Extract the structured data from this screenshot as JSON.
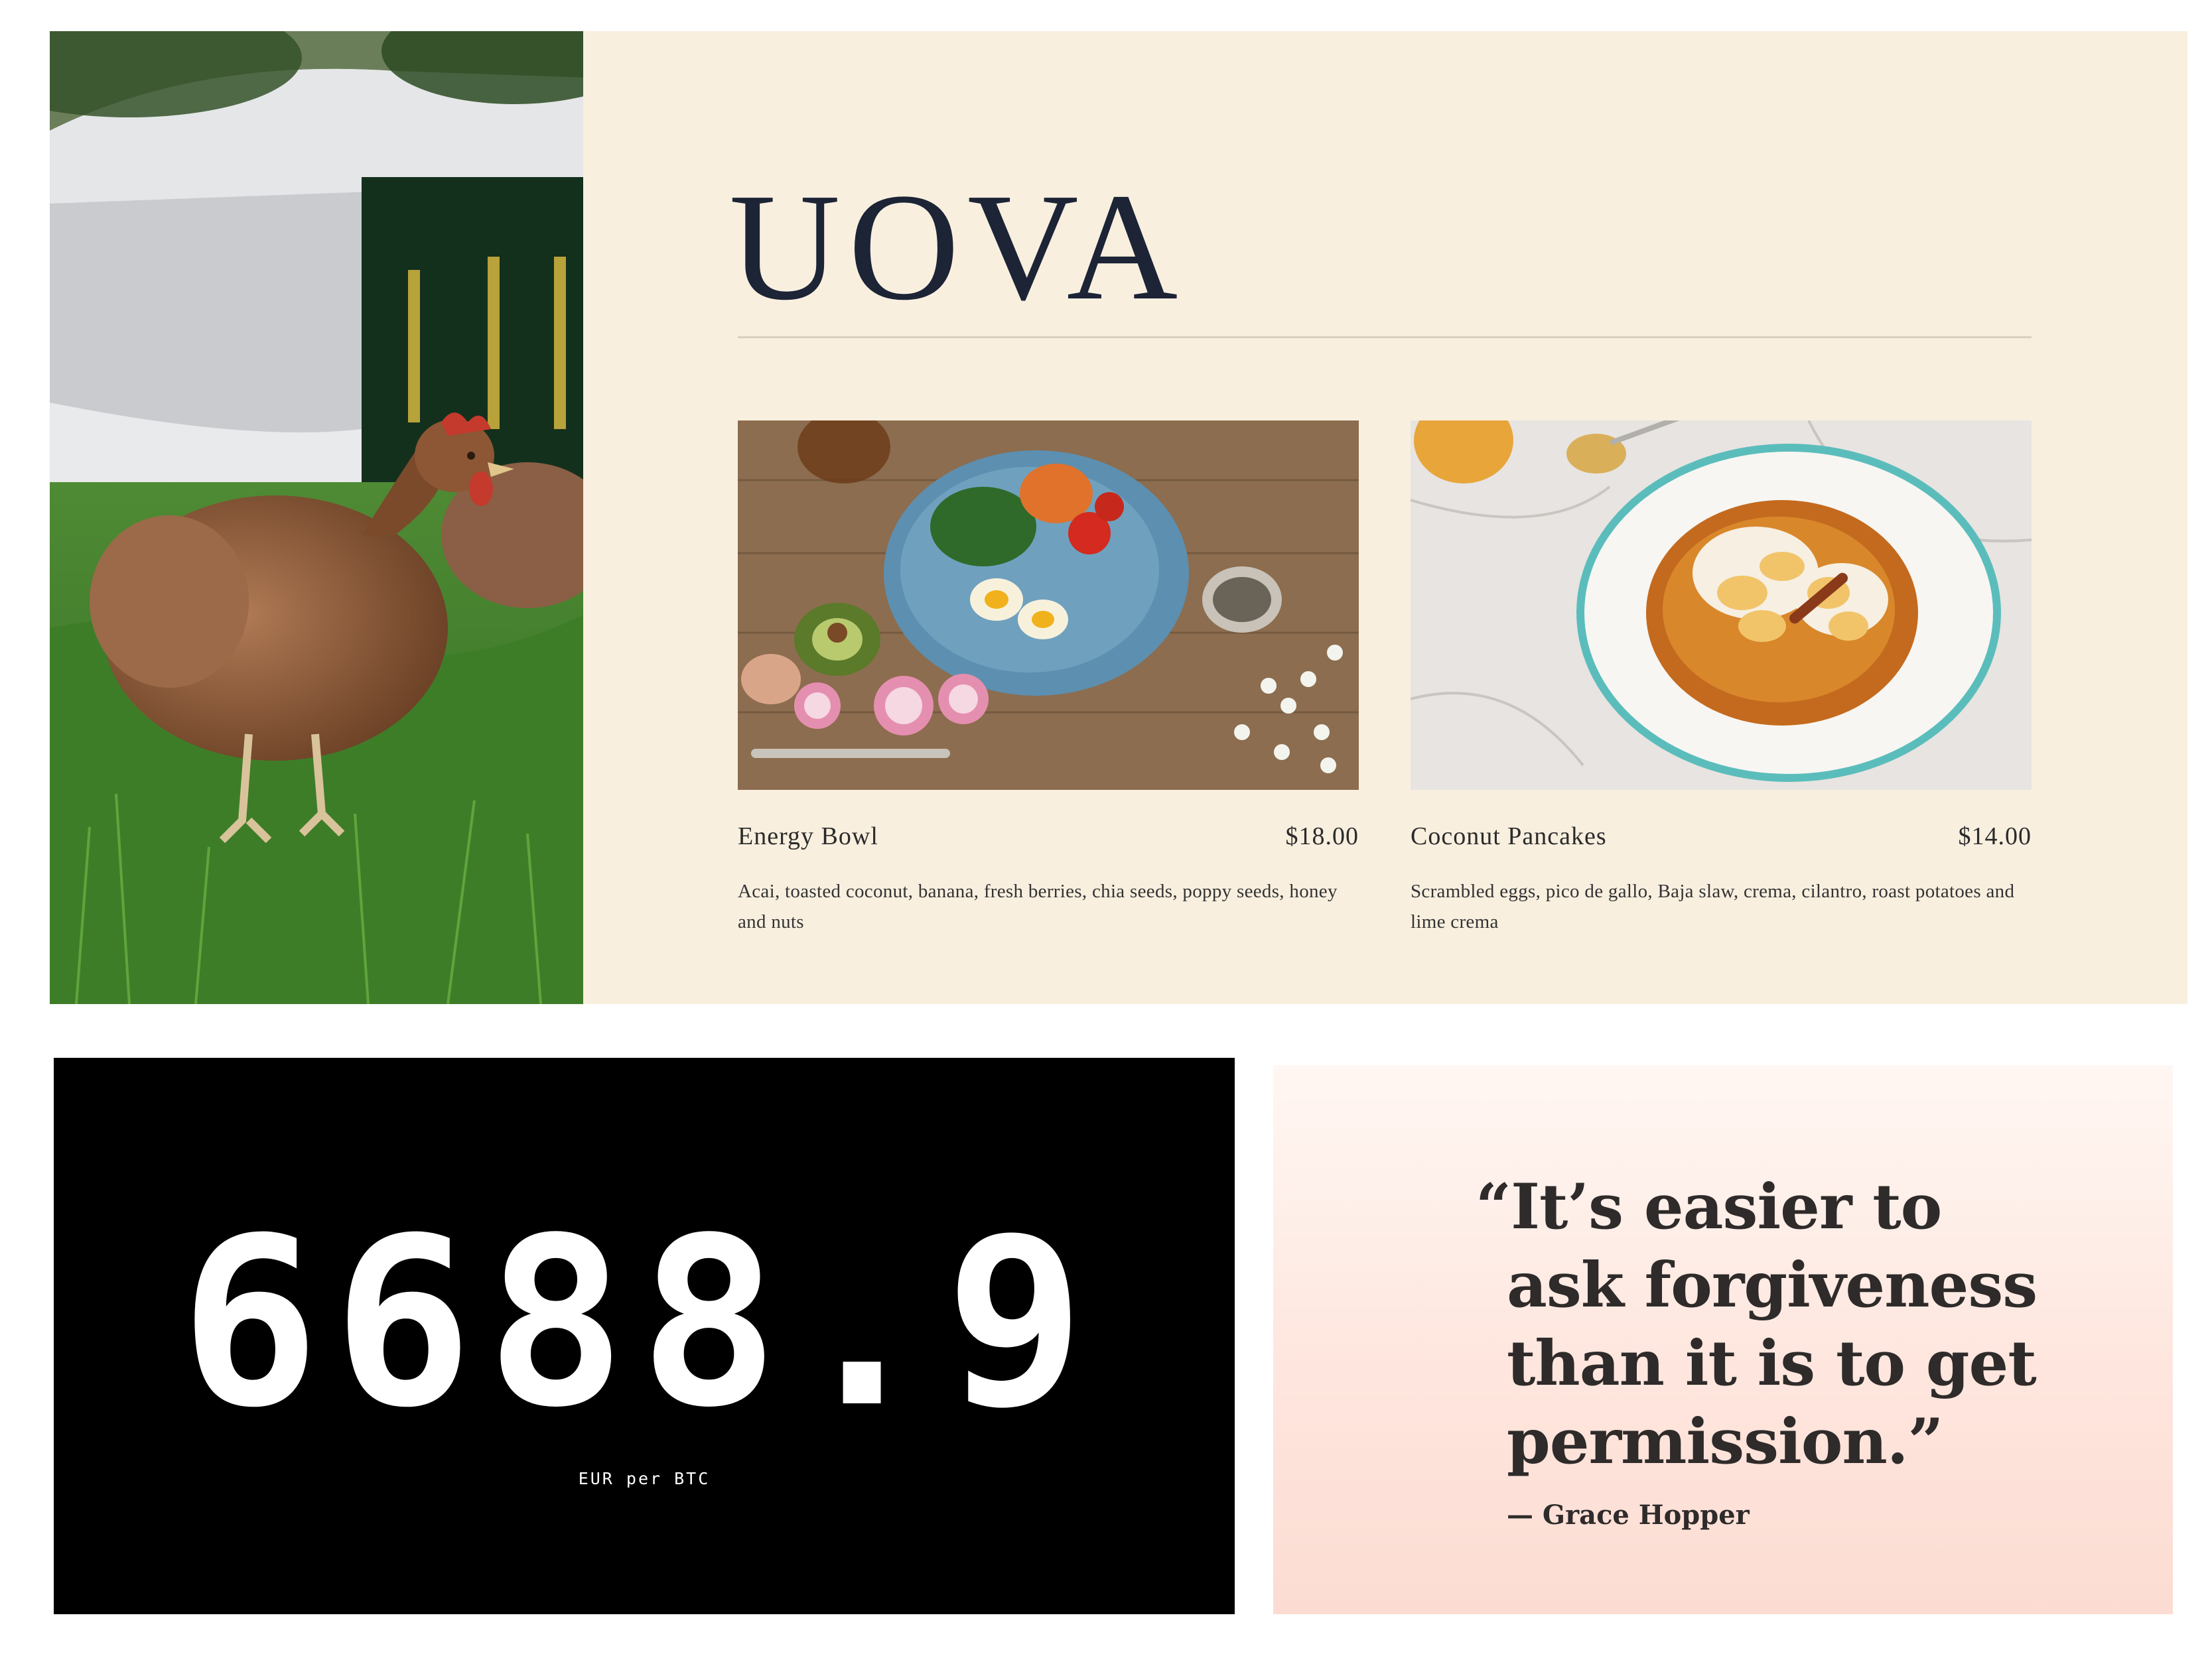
{
  "menu": {
    "brand": "UOVA",
    "dishes": [
      {
        "name": "Energy Bowl",
        "price": "$18.00",
        "description": "Acai, toasted coconut, banana, fresh berries, chia seeds, poppy seeds, honey and nuts",
        "photo": "bowl-photo"
      },
      {
        "name": "Coconut Pancakes",
        "price": "$14.00",
        "description": "Scrambled eggs, pico de gallo, Baja slaw, crema, cilantro, roast potatoes and lime crema",
        "photo": "pancakes-photo"
      }
    ],
    "colors": {
      "background": "#f8efdf",
      "title": "#1c2436"
    }
  },
  "ticker": {
    "value": "6688.9",
    "unit": "EUR per BTC",
    "colors": {
      "background": "#000000",
      "text": "#ffffff"
    }
  },
  "quote": {
    "lines": [
      "“It’s easier to",
      "ask forgiveness",
      "than it is to get",
      "permission.”"
    ],
    "author": "— Grace Hopper",
    "colors": {
      "gradient_top": "#fff7f3",
      "gradient_bottom": "#fcdcd2",
      "text": "#2e2b2a"
    }
  }
}
